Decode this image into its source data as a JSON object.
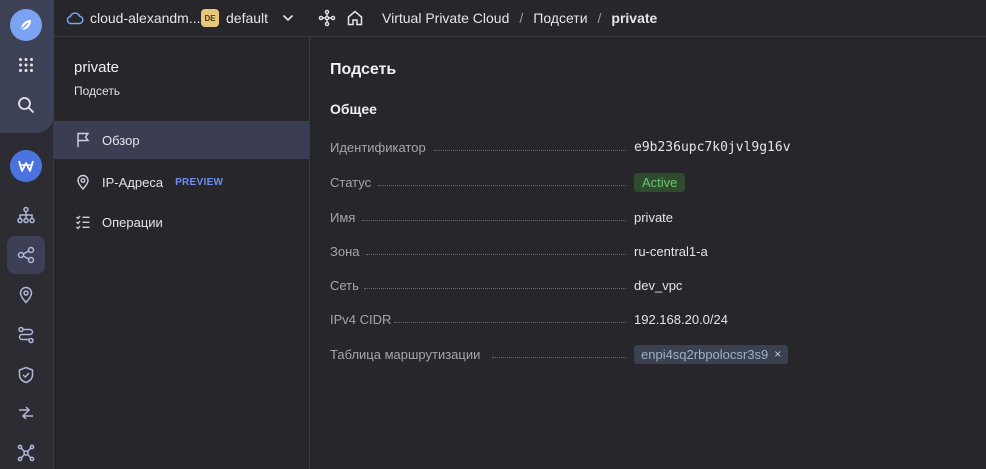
{
  "header": {
    "cloud_name": "cloud-alexandm...",
    "folder_badge": "DE",
    "folder_name": "default",
    "breadcrumbs": [
      "Virtual Private Cloud",
      "Подсети",
      "private"
    ],
    "separator": "/"
  },
  "rail": {
    "icons": [
      "logo-icon",
      "apps-grid-icon",
      "search-icon",
      "cloud-service-icon",
      "network-tree-icon",
      "vpc-icon",
      "location-pin-icon",
      "route-icon",
      "shield-icon",
      "arrows-exchange-icon",
      "nodes-icon"
    ],
    "active": "vpc-icon"
  },
  "sidebar": {
    "title": "private",
    "subtitle": "Подсеть",
    "items": [
      {
        "label": "Обзор",
        "icon": "flag-icon",
        "active": true
      },
      {
        "label": "IP-Адреса",
        "icon": "location-pin-icon",
        "tag": "PREVIEW"
      },
      {
        "label": "Операции",
        "icon": "checklist-icon"
      }
    ]
  },
  "main": {
    "page_title": "Подсеть",
    "section_title": "Общее",
    "fields": [
      {
        "label": "Идентификатор",
        "value": "e9b236upc7k0jvl9g16v"
      },
      {
        "label": "Статус",
        "value": "Active"
      },
      {
        "label": "Имя",
        "value": "private"
      },
      {
        "label": "Зона",
        "value": "ru-central1-a"
      },
      {
        "label": "Сеть",
        "value": "dev_vpc"
      },
      {
        "label": "IPv4 CIDR",
        "value": "192.168.20.0/24"
      },
      {
        "label": "Таблица маршрутизации",
        "value": "enpi4sq2rbpolocsr3s9",
        "close": "×"
      }
    ]
  },
  "colors": {
    "background": "#27262b",
    "accent": "#6d8df0",
    "status_active": "#6bc76b",
    "active_item": "#3b3d52"
  }
}
